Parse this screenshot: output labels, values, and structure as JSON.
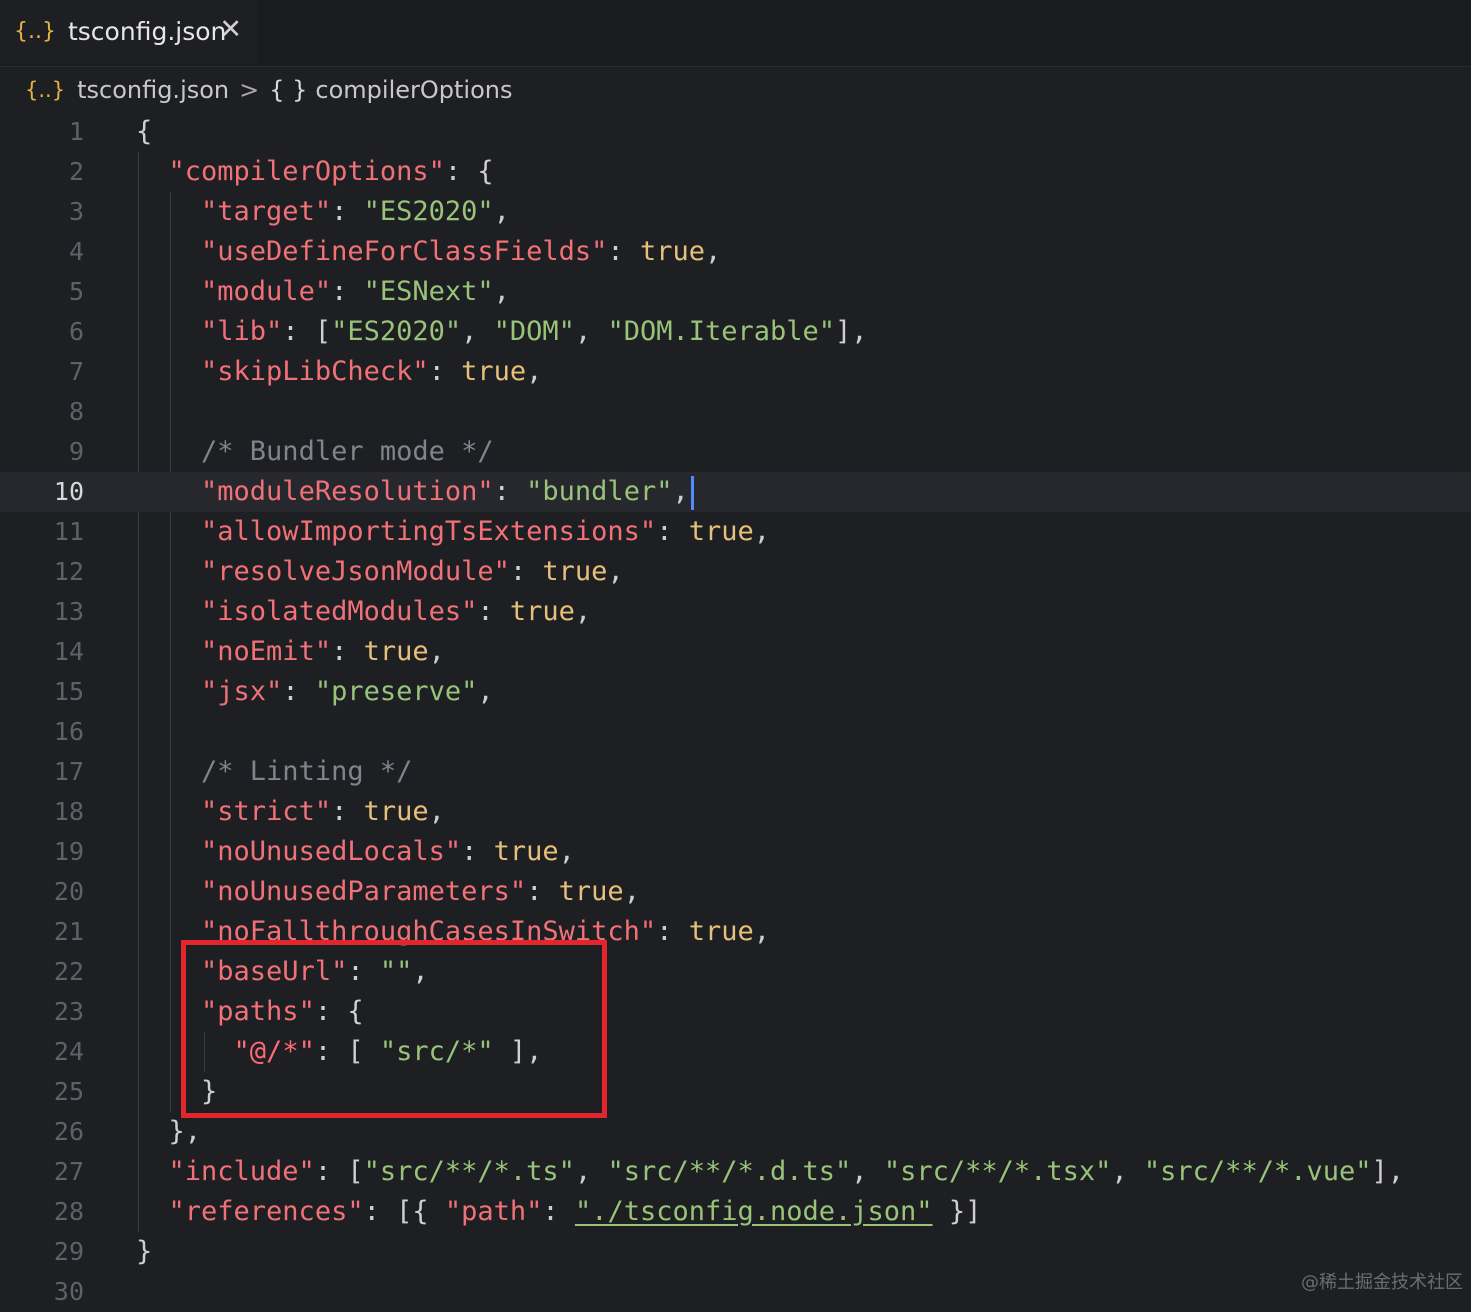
{
  "tab": {
    "icon": "{..}",
    "label": "tsconfig.json",
    "close": "✕"
  },
  "breadcrumb": {
    "icon": "{..}",
    "file": "tsconfig.json",
    "sep": ">",
    "braces": "{ }",
    "symbol": "compilerOptions"
  },
  "editor": {
    "current_line": 10,
    "lines": [
      [
        [
          "p",
          "{"
        ]
      ],
      [
        [
          "p",
          "  "
        ],
        [
          "k",
          "\"compilerOptions\""
        ],
        [
          "p",
          ": {"
        ]
      ],
      [
        [
          "p",
          "    "
        ],
        [
          "k",
          "\"target\""
        ],
        [
          "p",
          ": "
        ],
        [
          "s",
          "\"ES2020\""
        ],
        [
          "p",
          ","
        ]
      ],
      [
        [
          "p",
          "    "
        ],
        [
          "k",
          "\"useDefineForClassFields\""
        ],
        [
          "p",
          ": "
        ],
        [
          "b",
          "true"
        ],
        [
          "p",
          ","
        ]
      ],
      [
        [
          "p",
          "    "
        ],
        [
          "k",
          "\"module\""
        ],
        [
          "p",
          ": "
        ],
        [
          "s",
          "\"ESNext\""
        ],
        [
          "p",
          ","
        ]
      ],
      [
        [
          "p",
          "    "
        ],
        [
          "k",
          "\"lib\""
        ],
        [
          "p",
          ": ["
        ],
        [
          "s",
          "\"ES2020\""
        ],
        [
          "p",
          ", "
        ],
        [
          "s",
          "\"DOM\""
        ],
        [
          "p",
          ", "
        ],
        [
          "s",
          "\"DOM.Iterable\""
        ],
        [
          "p",
          "],"
        ]
      ],
      [
        [
          "p",
          "    "
        ],
        [
          "k",
          "\"skipLibCheck\""
        ],
        [
          "p",
          ": "
        ],
        [
          "b",
          "true"
        ],
        [
          "p",
          ","
        ]
      ],
      [],
      [
        [
          "p",
          "    "
        ],
        [
          "c",
          "/* Bundler mode */"
        ]
      ],
      [
        [
          "p",
          "    "
        ],
        [
          "k",
          "\"moduleResolution\""
        ],
        [
          "p",
          ": "
        ],
        [
          "s",
          "\"bundler\""
        ],
        [
          "p",
          ","
        ]
      ],
      [
        [
          "p",
          "    "
        ],
        [
          "k",
          "\"allowImportingTsExtensions\""
        ],
        [
          "p",
          ": "
        ],
        [
          "b",
          "true"
        ],
        [
          "p",
          ","
        ]
      ],
      [
        [
          "p",
          "    "
        ],
        [
          "k",
          "\"resolveJsonModule\""
        ],
        [
          "p",
          ": "
        ],
        [
          "b",
          "true"
        ],
        [
          "p",
          ","
        ]
      ],
      [
        [
          "p",
          "    "
        ],
        [
          "k",
          "\"isolatedModules\""
        ],
        [
          "p",
          ": "
        ],
        [
          "b",
          "true"
        ],
        [
          "p",
          ","
        ]
      ],
      [
        [
          "p",
          "    "
        ],
        [
          "k",
          "\"noEmit\""
        ],
        [
          "p",
          ": "
        ],
        [
          "b",
          "true"
        ],
        [
          "p",
          ","
        ]
      ],
      [
        [
          "p",
          "    "
        ],
        [
          "k",
          "\"jsx\""
        ],
        [
          "p",
          ": "
        ],
        [
          "s",
          "\"preserve\""
        ],
        [
          "p",
          ","
        ]
      ],
      [],
      [
        [
          "p",
          "    "
        ],
        [
          "c",
          "/* Linting */"
        ]
      ],
      [
        [
          "p",
          "    "
        ],
        [
          "k",
          "\"strict\""
        ],
        [
          "p",
          ": "
        ],
        [
          "b",
          "true"
        ],
        [
          "p",
          ","
        ]
      ],
      [
        [
          "p",
          "    "
        ],
        [
          "k",
          "\"noUnusedLocals\""
        ],
        [
          "p",
          ": "
        ],
        [
          "b",
          "true"
        ],
        [
          "p",
          ","
        ]
      ],
      [
        [
          "p",
          "    "
        ],
        [
          "k",
          "\"noUnusedParameters\""
        ],
        [
          "p",
          ": "
        ],
        [
          "b",
          "true"
        ],
        [
          "p",
          ","
        ]
      ],
      [
        [
          "p",
          "    "
        ],
        [
          "k",
          "\"noFallthroughCasesInSwitch\""
        ],
        [
          "p",
          ": "
        ],
        [
          "b",
          "true"
        ],
        [
          "p",
          ","
        ]
      ],
      [
        [
          "p",
          "    "
        ],
        [
          "k",
          "\"baseUrl\""
        ],
        [
          "p",
          ": "
        ],
        [
          "s",
          "\"\""
        ],
        [
          "p",
          ","
        ]
      ],
      [
        [
          "p",
          "    "
        ],
        [
          "k",
          "\"paths\""
        ],
        [
          "p",
          ": {"
        ]
      ],
      [
        [
          "p",
          "      "
        ],
        [
          "k2",
          "\"@/*\""
        ],
        [
          "p",
          ": [ "
        ],
        [
          "s",
          "\"src/*\""
        ],
        [
          "p",
          " ],"
        ]
      ],
      [
        [
          "p",
          "    }"
        ]
      ],
      [
        [
          "p",
          "  },"
        ]
      ],
      [
        [
          "p",
          "  "
        ],
        [
          "k",
          "\"include\""
        ],
        [
          "p",
          ": ["
        ],
        [
          "s",
          "\"src/**/*.ts\""
        ],
        [
          "p",
          ", "
        ],
        [
          "s",
          "\"src/**/*.d.ts\""
        ],
        [
          "p",
          ", "
        ],
        [
          "s",
          "\"src/**/*.tsx\""
        ],
        [
          "p",
          ", "
        ],
        [
          "s",
          "\"src/**/*.vue\""
        ],
        [
          "p",
          "],"
        ]
      ],
      [
        [
          "p",
          "  "
        ],
        [
          "k",
          "\"references\""
        ],
        [
          "p",
          ": [{ "
        ],
        [
          "k",
          "\"path\""
        ],
        [
          "p",
          ": "
        ],
        [
          "s",
          "\"./tsconfig.node.json\""
        ],
        [
          "p",
          " }]"
        ]
      ],
      [
        [
          "p",
          "}"
        ]
      ],
      []
    ]
  },
  "colors": {
    "background": "#1e1f22",
    "key": "#f07178",
    "string": "#98c379",
    "boolean": "#e5c07b",
    "comment": "#7f848e",
    "highlight_box": "#e3262e",
    "cursor": "#528bff"
  },
  "icons": [
    "json-file-icon",
    "close-icon",
    "braces-icon"
  ],
  "watermark": "@稀土掘金技术社区"
}
